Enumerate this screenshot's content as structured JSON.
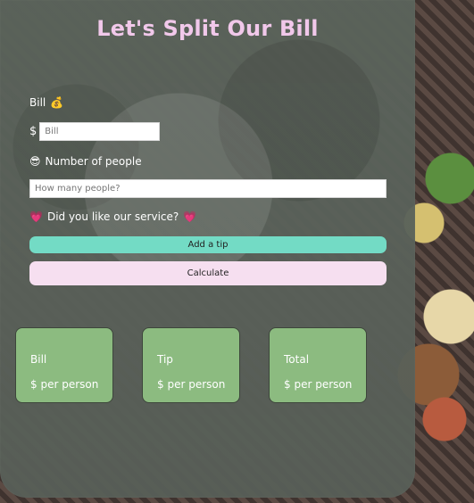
{
  "app": {
    "title": "Let's Split Our Bill"
  },
  "form": {
    "bill_label": "Bill",
    "bill_emoji": "💰",
    "currency_symbol": "$",
    "bill_placeholder": "Bill",
    "people_emoji": "😎",
    "people_label": "Number of people",
    "people_placeholder": "How many people?",
    "service_emoji_left": "💗",
    "service_label": "Did you like our service?",
    "service_emoji_right": "💗",
    "tip_button": "Add a tip",
    "calculate_button": "Calculate"
  },
  "results": {
    "bill": {
      "title": "Bill",
      "value": "$ per person"
    },
    "tip": {
      "title": "Tip",
      "value": "$ per person"
    },
    "total": {
      "title": "Total",
      "value": "$ per person"
    }
  },
  "colors": {
    "title": "#f1c8ea",
    "tip_button": "#73dbc5",
    "calculate_button": "#f6dff0",
    "result_cards": "#8cbb80",
    "panel": "#5b635b"
  },
  "icons": {
    "bill": "money-bag-icon",
    "people": "sunglasses-face-icon",
    "service_left": "heart-icon",
    "service_right": "heart-icon"
  }
}
